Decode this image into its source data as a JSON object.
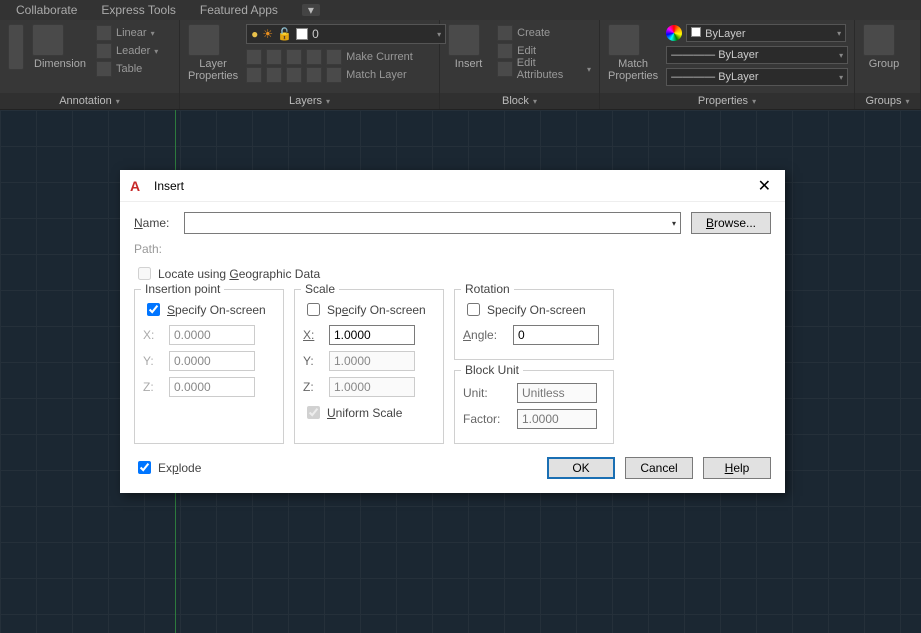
{
  "menubar": {
    "items": [
      "Collaborate",
      "Express Tools",
      "Featured Apps"
    ]
  },
  "ribbon": {
    "annotation": {
      "title": "Annotation",
      "dimension": "Dimension",
      "linear": "Linear",
      "leader": "Leader",
      "table": "Table"
    },
    "layers": {
      "title": "Layers",
      "properties": "Layer\nProperties",
      "current_layer": "0",
      "make_current": "Make Current",
      "match_layer": "Match Layer"
    },
    "block": {
      "title": "Block",
      "insert": "Insert",
      "create": "Create",
      "edit": "Edit",
      "edit_attributes": "Edit Attributes"
    },
    "properties": {
      "title": "Properties",
      "match": "Match\nProperties",
      "bylayer": "ByLayer"
    },
    "groups": {
      "title": "Groups",
      "group": "Group"
    }
  },
  "dialog": {
    "title": "Insert",
    "name_label": "Name:",
    "name_value": "",
    "browse": "Browse...",
    "path_label": "Path:",
    "geo_label": "Locate using Geographic Data",
    "insertion": {
      "legend": "Insertion point",
      "specify": "Specify On-screen",
      "x": "0.0000",
      "y": "0.0000",
      "z": "0.0000"
    },
    "scale": {
      "legend": "Scale",
      "specify": "Specify On-screen",
      "x": "1.0000",
      "y": "1.0000",
      "z": "1.0000",
      "uniform": "Uniform Scale"
    },
    "rotation": {
      "legend": "Rotation",
      "specify": "Specify On-screen",
      "angle_label": "Angle:",
      "angle": "0"
    },
    "block_unit": {
      "legend": "Block Unit",
      "unit_label": "Unit:",
      "unit": "Unitless",
      "factor_label": "Factor:",
      "factor": "1.0000"
    },
    "explode": "Explode",
    "ok": "OK",
    "cancel": "Cancel",
    "help": "Help"
  }
}
